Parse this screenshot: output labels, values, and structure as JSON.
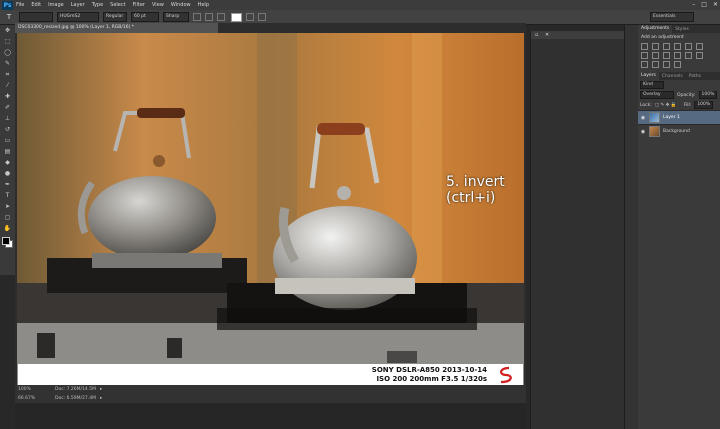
{
  "app": {
    "logo": "Ps"
  },
  "menu": [
    "File",
    "Edit",
    "Image",
    "Layer",
    "Type",
    "Select",
    "Filter",
    "View",
    "Window",
    "Help"
  ],
  "window_controls": {
    "minimize": "–",
    "maximize": "□",
    "close": "✕"
  },
  "options_bar": {
    "font_family": "HUGmS2",
    "font_style": "Regular",
    "font_size": "60 pt",
    "anti_alias": "Sharp",
    "workspace": "Essentials",
    "tool_icon": "T"
  },
  "document": {
    "tab_title": "DSC03300_resized.jpg @ 100% (Layer 1, RGB/16) *",
    "annotation": "5. invert (ctrl+i)",
    "exif_line1": "SONY DSLR-A850 2013-10-14",
    "exif_line2": "ISO 200 200mm F3.5 1/320s"
  },
  "status_bar": {
    "zoom": "100%",
    "doc": "Doc: 7.26M/14.5M"
  },
  "lower_status": {
    "zoom": "66.67%",
    "doc": "Doc: 6.59M/27.4M"
  },
  "panels": {
    "adjust_tabs": [
      "Adjustments",
      "Styles"
    ],
    "adjust_title": "Add an adjustment",
    "layers_tabs": [
      "Layers",
      "Channels",
      "Paths"
    ],
    "kind": "Kind",
    "blend_mode": "Overlay",
    "opacity_label": "Opacity:",
    "opacity": "100%",
    "lock_label": "Lock:",
    "fill_label": "Fill:",
    "fill": "100%",
    "layers": [
      {
        "name": "Layer 1",
        "selected": true
      },
      {
        "name": "Background",
        "selected": false
      }
    ]
  },
  "colors": {
    "selected_layer": "#566a82",
    "ui_dark": "#282828"
  }
}
